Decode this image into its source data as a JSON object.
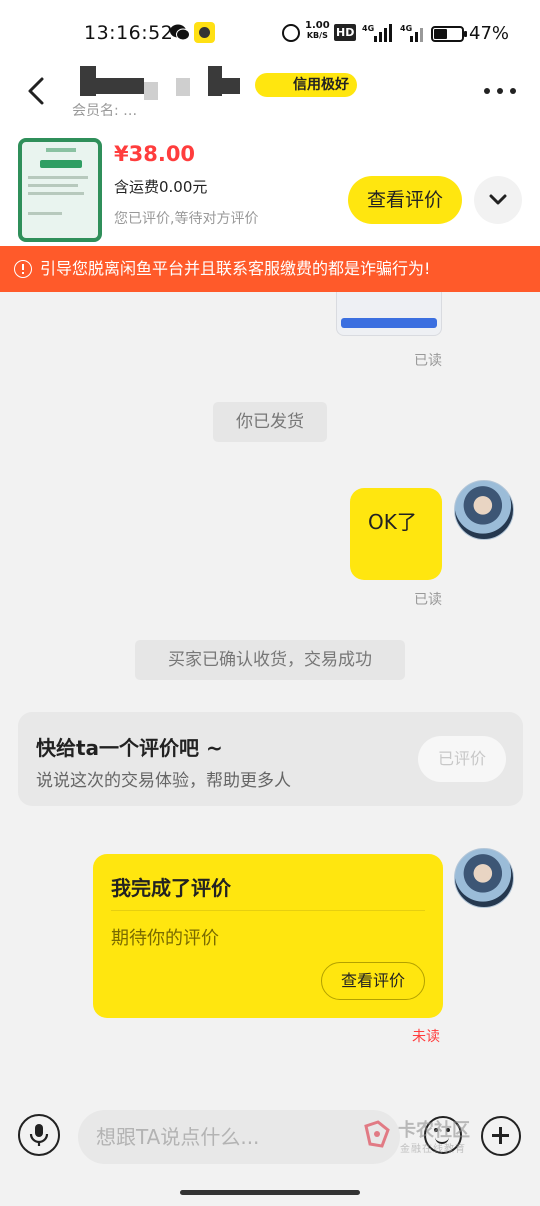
{
  "status_bar": {
    "time": "13:16:52",
    "net_speed_value": "1.00",
    "net_speed_unit": "KB/S",
    "hd_label": "HD",
    "battery_pct": "47%",
    "icons": [
      "wechat-icon",
      "app-notification-icon",
      "alarm-icon",
      "signal-4g-icon",
      "signal-4g-icon",
      "battery-icon"
    ]
  },
  "header": {
    "credit_badge": "信用极好",
    "seller_sub": "会员名: … ",
    "back_icon": "back-arrow-icon",
    "more_icon": "more-dots-icon"
  },
  "product": {
    "price": "¥38.00",
    "shipping": "含运费0.00元",
    "status_hint": "您已评价,等待对方评价",
    "view_review_label": "查看评价",
    "expand_icon": "chevron-down-icon"
  },
  "warning": {
    "text": "引导您脱离闲鱼平台并且联系客服缴费的都是诈骗行为!",
    "icon": "alert-circle-icon"
  },
  "chat": {
    "read_label_1": "已读",
    "system_shipped": "你已发货",
    "ok_message": "OK了",
    "read_label_2": "已读",
    "system_confirmed": "买家已确认收货，交易成功",
    "review_prompt": {
      "title": "快给ta一个评价吧 ~",
      "subtitle": "说说这次的交易体验，帮助更多人",
      "button": "已评价"
    },
    "review_card": {
      "title": "我完成了评价",
      "subtitle": "期待你的评价",
      "button": "查看评价"
    },
    "unread_label": "未读"
  },
  "input_bar": {
    "placeholder": "想跟TA说点什么...",
    "mic_icon": "microphone-icon",
    "emoji_icon": "emoji-icon",
    "plus_icon": "plus-circle-icon"
  },
  "watermark": {
    "line1": "卡农社区",
    "line2": "金融在线教育"
  },
  "colors": {
    "accent_yellow": "#ffe60f",
    "price_red": "#ff3d3d",
    "warning_orange": "#ff5a2a"
  }
}
